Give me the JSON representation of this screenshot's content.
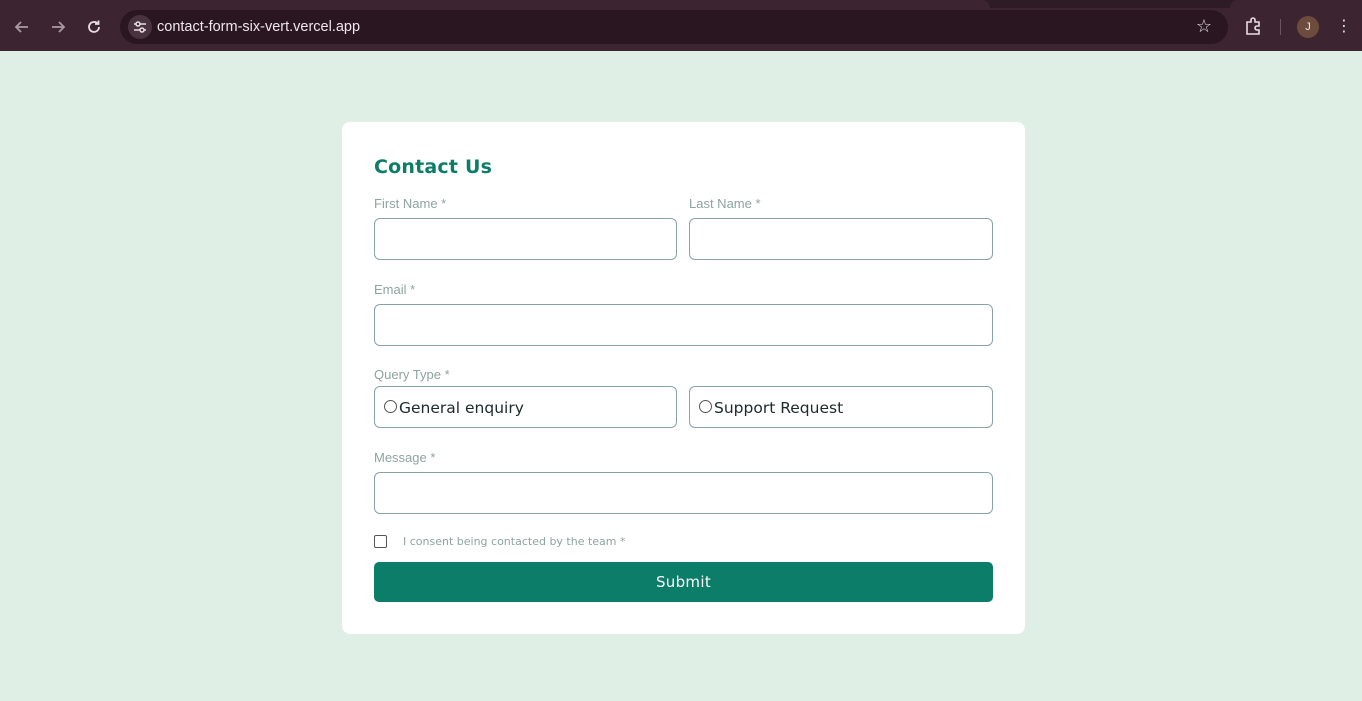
{
  "browser": {
    "url": "contact-form-six-vert.vercel.app",
    "profile_initial": "J",
    "back_icon": "arrow-left-icon",
    "forward_icon": "arrow-right-icon",
    "reload_icon": "reload-icon",
    "bookmark_icon": "star-icon",
    "extensions_icon": "puzzle-icon",
    "menu_icon": "kebab-menu-icon"
  },
  "form": {
    "title": "Contact Us",
    "first_name_label": "First Name *",
    "first_name_value": "",
    "last_name_label": "Last Name *",
    "last_name_value": "",
    "email_label": "Email *",
    "email_value": "",
    "query_type_label": "Query Type *",
    "query_options": [
      {
        "label": "General enquiry",
        "selected": false
      },
      {
        "label": "Support Request",
        "selected": false
      }
    ],
    "message_label": "Message *",
    "message_value": "",
    "consent_label": "I consent being contacted by the team *",
    "consent_checked": false,
    "submit_label": "Submit"
  },
  "colors": {
    "page_background": "#dfefe6",
    "accent": "#0c7d69",
    "card_background": "#ffffff",
    "label_text": "#8fa3a0",
    "field_border": "#87a3a6"
  }
}
